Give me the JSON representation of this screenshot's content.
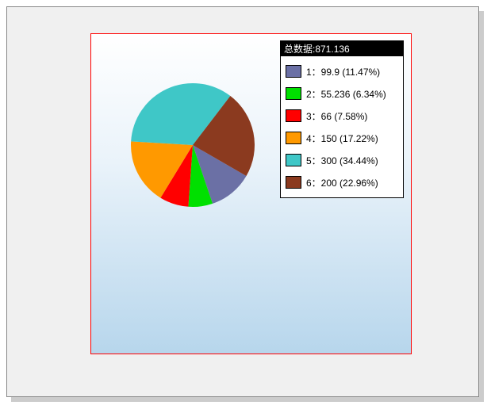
{
  "chart_data": {
    "type": "pie",
    "total_label": "总数据",
    "total_value": 871.136,
    "series": [
      {
        "id": "1",
        "value": 99.9,
        "pct": 11.47,
        "color": "#6b70a5"
      },
      {
        "id": "2",
        "value": 55.236,
        "pct": 6.34,
        "color": "#00e000"
      },
      {
        "id": "3",
        "value": 66,
        "pct": 7.58,
        "color": "#ff0000"
      },
      {
        "id": "4",
        "value": 150,
        "pct": 17.22,
        "color": "#ff9900"
      },
      {
        "id": "5",
        "value": 300,
        "pct": 34.44,
        "color": "#3fc7c7"
      },
      {
        "id": "6",
        "value": 200,
        "pct": 22.96,
        "color": "#8b3a1f"
      }
    ]
  },
  "legend": {
    "title": "总数据:871.136",
    "items": [
      "1：99.9 (11.47%)",
      "2：55.236 (6.34%)",
      "3：66 (7.58%)",
      "4：150 (17.22%)",
      "5：300 (34.44%)",
      "6：200 (22.96%)"
    ]
  }
}
